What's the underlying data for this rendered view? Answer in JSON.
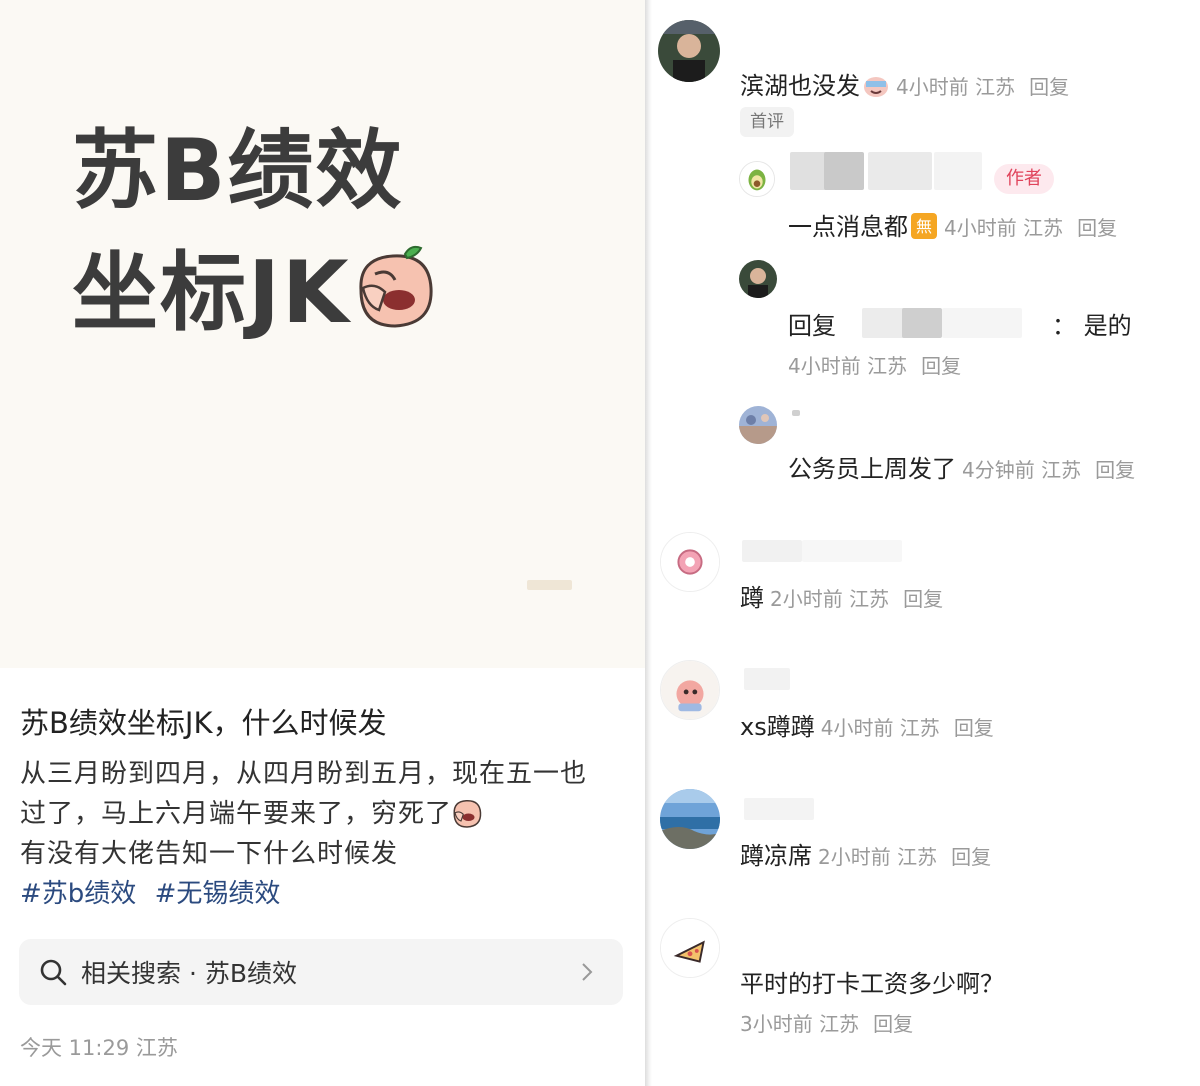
{
  "post": {
    "cover_line1": "苏B绩效",
    "cover_line2": "坐标JK",
    "title": "苏B绩效坐标JK，什么时候发",
    "body_line1": "从三月盼到四月，从四月盼到五月，现在五一也",
    "body_line2": "过了，马上六月端午要来了，穷死了",
    "body_line3": "有没有大佬告知一下什么时候发",
    "tags": [
      "#苏b绩效",
      "#无锡绩效"
    ],
    "related_search": "相关搜索 · 苏B绩效",
    "meta": "今天 11:29 江苏"
  },
  "comments": {
    "c1": {
      "text": "滨湖也没发",
      "meta": "4小时前 江苏",
      "reply": "回复",
      "tag": "首评"
    },
    "c1_r1": {
      "badge": "作者",
      "text": "一点消息都",
      "meta": "4小时前 江苏",
      "reply": "回复"
    },
    "c1_r2": {
      "text_prefix": "回复",
      "text_suffix": "：  是的",
      "meta": "4小时前 江苏",
      "reply": "回复"
    },
    "c1_r3": {
      "text": "公务员上周发了",
      "meta": "4分钟前 江苏",
      "reply": "回复"
    },
    "c2": {
      "text": "蹲",
      "meta": "2小时前 江苏",
      "reply": "回复"
    },
    "c3": {
      "text": "xs蹲蹲",
      "meta": "4小时前 江苏",
      "reply": "回复"
    },
    "c4": {
      "text": "蹲凉席",
      "meta": "2小时前 江苏",
      "reply": "回复"
    },
    "c5": {
      "text": "平时的打卡工资多少啊？",
      "meta": "3小时前 江苏",
      "reply": "回复"
    }
  },
  "colors": {
    "accent_tag": "#2b4a7f",
    "author_badge": "#e0435b",
    "cover_bg": "#fbf9f4"
  },
  "icons": [
    "search-icon",
    "chevron-right-icon",
    "facepalm-sticker",
    "crying-sticker",
    "wu-emoji"
  ]
}
